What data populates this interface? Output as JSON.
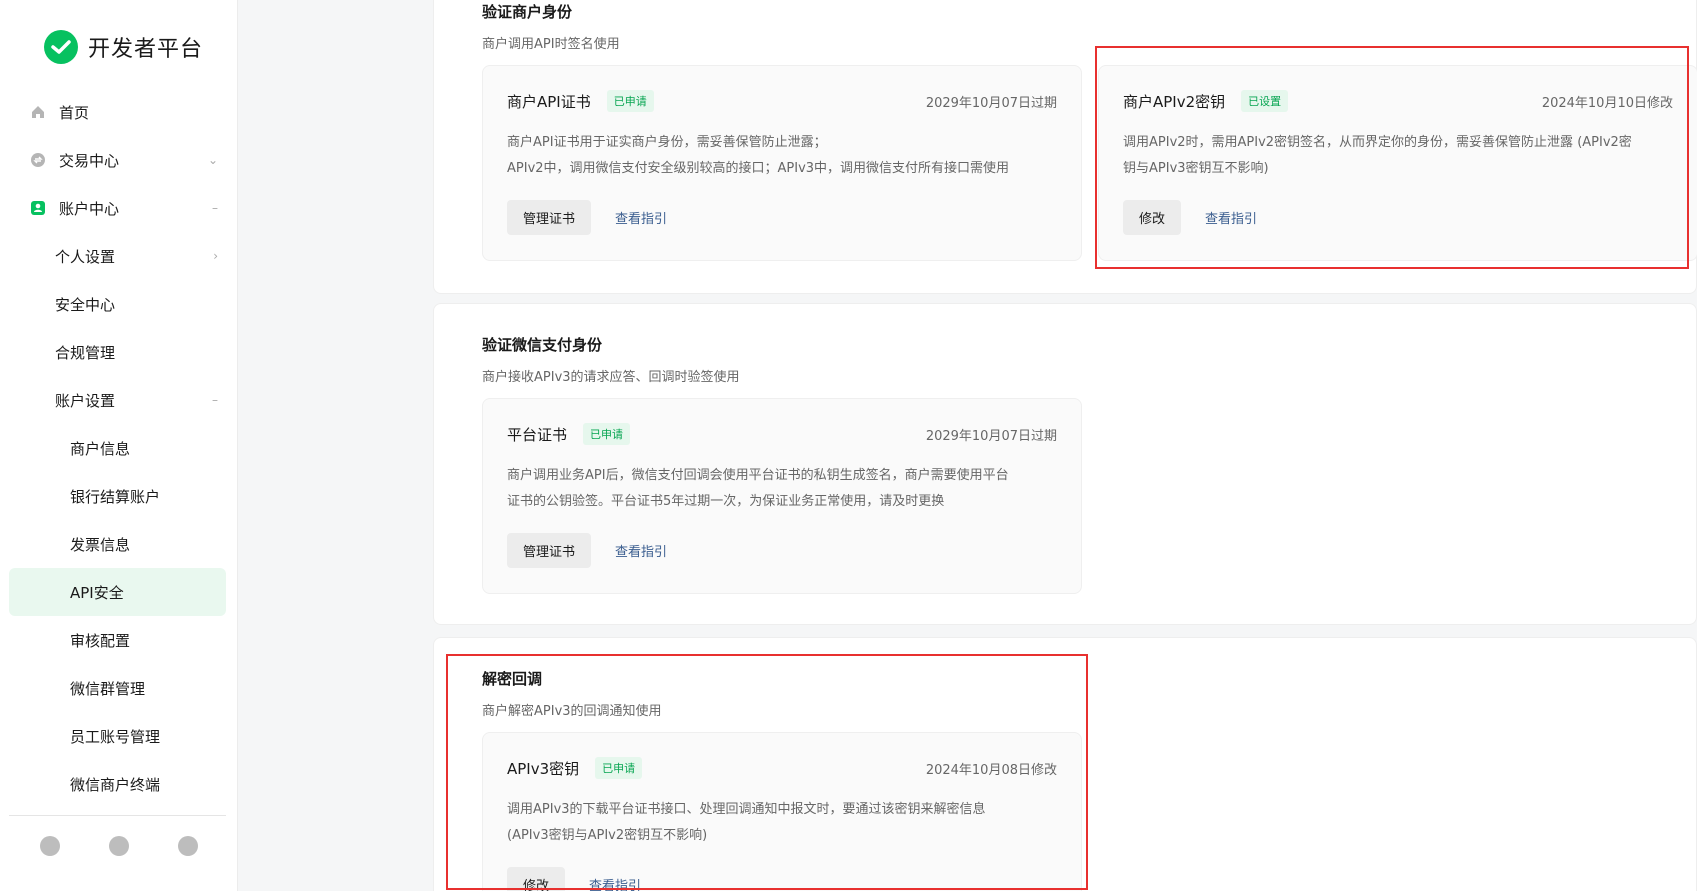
{
  "app": {
    "title": "开发者平台"
  },
  "sidebar": {
    "items": [
      {
        "label": "首页",
        "icon": "home-icon",
        "level": 0
      },
      {
        "label": "交易中心",
        "icon": "exchange-icon",
        "level": 0,
        "caret": "⌄"
      },
      {
        "label": "账户中心",
        "icon": "account-icon",
        "level": 0,
        "caret": "–"
      },
      {
        "label": "个人设置",
        "level": 1,
        "caret": "›"
      },
      {
        "label": "安全中心",
        "level": 1
      },
      {
        "label": "合规管理",
        "level": 1
      },
      {
        "label": "账户设置",
        "level": 1,
        "caret": "–"
      },
      {
        "label": "商户信息",
        "level": 2
      },
      {
        "label": "银行结算账户",
        "level": 2
      },
      {
        "label": "发票信息",
        "level": 2
      },
      {
        "label": "API安全",
        "level": 2,
        "active": true
      },
      {
        "label": "审核配置",
        "level": 2
      },
      {
        "label": "微信群管理",
        "level": 2
      },
      {
        "label": "员工账号管理",
        "level": 2
      },
      {
        "label": "微信商户终端",
        "level": 2
      }
    ]
  },
  "sections": {
    "merchant": {
      "title": "验证商户身份",
      "desc": "商户调用API时签名使用",
      "cards": [
        {
          "title": "商户API证书",
          "badge": "已申请",
          "date": "2029年10月07日过期",
          "desc_line1": "商户API证书用于证实商户身份，需妥善保管防止泄露；",
          "desc_line2": "APIv2中，调用微信支付安全级别较高的接口；APIv3中，调用微信支付所有接口需使用",
          "button": "管理证书",
          "link": "查看指引"
        },
        {
          "title": "商户APIv2密钥",
          "badge": "已设置",
          "date": "2024年10月10日修改",
          "desc_line1": "调用APIv2时，需用APIv2密钥签名，从而界定你的身份，需妥善保管防止泄露 (APIv2密",
          "desc_line2": "钥与APIv3密钥互不影响)",
          "button": "修改",
          "link": "查看指引"
        }
      ]
    },
    "wechatpay": {
      "title": "验证微信支付身份",
      "desc": "商户接收APIv3的请求应答、回调时验签使用",
      "card": {
        "title": "平台证书",
        "badge": "已申请",
        "date": "2029年10月07日过期",
        "desc_line1": "商户调用业务API后，微信支付回调会使用平台证书的私钥生成签名，商户需要使用平台",
        "desc_line2": "证书的公钥验签。平台证书5年过期一次，为保证业务正常使用，请及时更换",
        "button": "管理证书",
        "link": "查看指引"
      }
    },
    "decrypt": {
      "title": "解密回调",
      "desc": "商户解密APIv3的回调通知使用",
      "card": {
        "title": "APIv3密钥",
        "badge": "已申请",
        "date": "2024年10月08日修改",
        "desc_line1": "调用APIv3的下载平台证书接口、处理回调通知中报文时，要通过该密钥来解密信息",
        "desc_line2": "(APIv3密钥与APIv2密钥互不影响)",
        "button": "修改",
        "link": "查看指引"
      }
    }
  },
  "colors": {
    "brand": "#07c160",
    "highlight": "#e8302f",
    "link": "#3a5d8f"
  }
}
